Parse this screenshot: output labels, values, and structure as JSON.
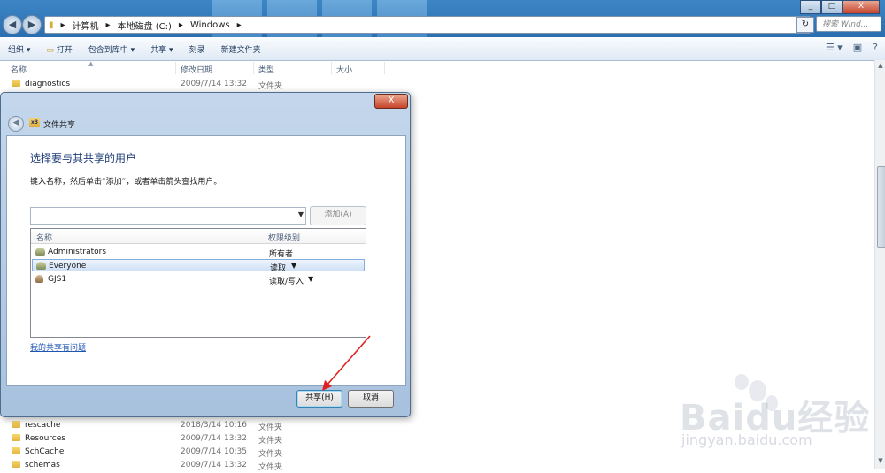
{
  "titlebar": {
    "address_segments": [
      "计算机",
      "本地磁盘 (C:)",
      "Windows"
    ],
    "search_placeholder": "搜索 Wind...",
    "controls": [
      "_",
      "□",
      "X"
    ]
  },
  "toolbar": {
    "items": [
      "组织 ▾",
      "打开",
      "包含到库中 ▾",
      "共享 ▾",
      "刻录",
      "新建文件夹"
    ]
  },
  "columns": {
    "name": "名称",
    "date": "修改日期",
    "type": "类型",
    "size": "大小"
  },
  "files_top": [
    {
      "name": "diagnostics",
      "date": "2009/7/14 13:32",
      "type": "文件夹"
    }
  ],
  "files_bottom": [
    {
      "name": "rescache",
      "date": "2018/3/14 10:16",
      "type": "文件夹"
    },
    {
      "name": "Resources",
      "date": "2009/7/14 13:32",
      "type": "文件夹"
    },
    {
      "name": "SchCache",
      "date": "2009/7/14 10:35",
      "type": "文件夹"
    },
    {
      "name": "schemas",
      "date": "2009/7/14 13:32",
      "type": "文件夹"
    }
  ],
  "dialog": {
    "title": "文件共享",
    "close_label": "X",
    "heading": "选择要与其共享的用户",
    "instruction": "键入名称，然后单击“添加”，或者单击箭头查找用户。",
    "combo_value": "",
    "add_button": "添加(A)",
    "list_headers": {
      "name": "名称",
      "level": "权限级别"
    },
    "users": [
      {
        "name": "Administrators",
        "level": "所有者",
        "has_dropdown": false,
        "selected": false
      },
      {
        "name": "Everyone",
        "level": "读取",
        "has_dropdown": true,
        "selected": true
      },
      {
        "name": "GJS1",
        "level": "读取/写入",
        "has_dropdown": true,
        "selected": false
      }
    ],
    "help_link": "我的共享有问题",
    "share_button": "共享(H)",
    "cancel_button": "取消"
  },
  "watermark": {
    "brand": "Baidu经验",
    "url": "jingyan.baidu.com"
  },
  "colors": {
    "accent": "#2b6eb0",
    "heading": "#1e3c78",
    "link": "#1f56b3",
    "annotation_arrow": "#e02020"
  }
}
